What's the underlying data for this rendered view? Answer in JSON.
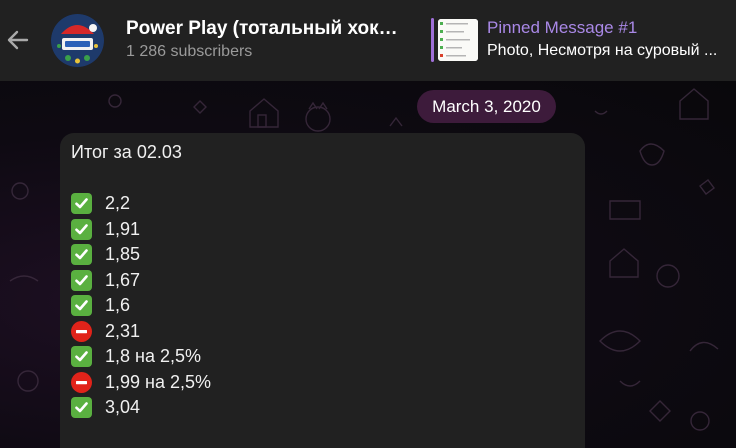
{
  "header": {
    "title": "Power Play (тотальный хокк...",
    "subscribers": "1 286 subscribers",
    "pinned": {
      "title": "Pinned Message #1",
      "text": "Photo, Несмотря на суровый ..."
    }
  },
  "chat": {
    "date": "March 3, 2020",
    "message": {
      "title": "Итог за 02.03",
      "results": [
        {
          "status": "win",
          "text": "2,2"
        },
        {
          "status": "win",
          "text": "1,91"
        },
        {
          "status": "win",
          "text": "1,85"
        },
        {
          "status": "win",
          "text": "1,67"
        },
        {
          "status": "win",
          "text": "1,6"
        },
        {
          "status": "loss",
          "text": "2,31"
        },
        {
          "status": "win",
          "text": "1,8 на 2,5%"
        },
        {
          "status": "loss",
          "text": "1,99 на 2,5%"
        },
        {
          "status": "win",
          "text": "3,04"
        }
      ]
    }
  },
  "icons": {
    "win": "check-mark-button-icon",
    "loss": "no-entry-icon",
    "back": "arrow-left-icon"
  },
  "colors": {
    "header_bg": "#212121",
    "accent": "#a988e6",
    "date_pill": "#3d1b3b",
    "bubble_bg": "#212121",
    "win": "#5ab040",
    "loss": "#e1231a"
  }
}
